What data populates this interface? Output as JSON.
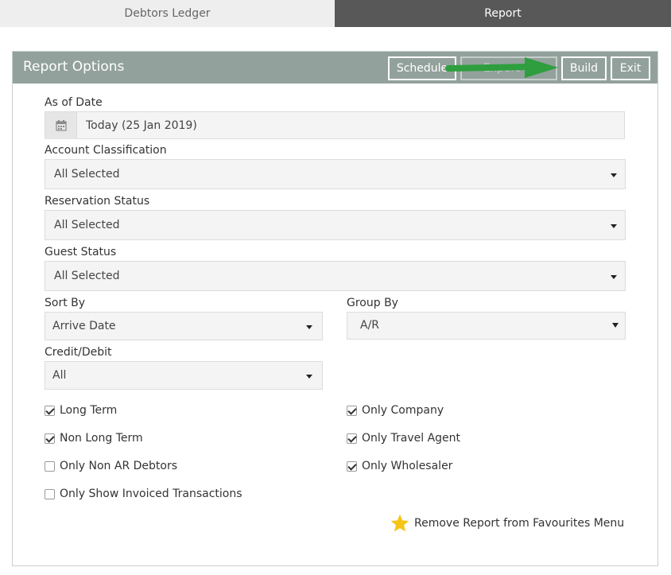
{
  "tabs": [
    {
      "label": "Debtors Ledger",
      "active": false
    },
    {
      "label": "Report",
      "active": true
    }
  ],
  "panel": {
    "title": "Report Options",
    "buttons": {
      "schedule": "Schedule",
      "export": "Export to",
      "build": "Build",
      "exit": "Exit"
    }
  },
  "form": {
    "as_of_date": {
      "label": "As of Date",
      "value": "Today (25 Jan 2019)",
      "icon": "calendar-icon"
    },
    "account_classification": {
      "label": "Account Classification",
      "value": "All Selected"
    },
    "reservation_status": {
      "label": "Reservation Status",
      "value": "All Selected"
    },
    "guest_status": {
      "label": "Guest Status",
      "value": "All Selected"
    },
    "sort_by": {
      "label": "Sort By",
      "value": "Arrive Date"
    },
    "group_by": {
      "label": "Group By",
      "value": "A/R"
    },
    "credit_debit": {
      "label": "Credit/Debit",
      "value": "All"
    }
  },
  "checkboxes": {
    "long_term": {
      "label": "Long Term",
      "checked": true
    },
    "non_long_term": {
      "label": "Non Long Term",
      "checked": true
    },
    "only_non_ar_debtors": {
      "label": "Only Non AR Debtors",
      "checked": false
    },
    "only_show_invoiced": {
      "label": "Only Show Invoiced Transactions",
      "checked": false
    },
    "only_company": {
      "label": "Only Company",
      "checked": true
    },
    "only_travel_agent": {
      "label": "Only Travel Agent",
      "checked": true
    },
    "only_wholesaler": {
      "label": "Only Wholesaler",
      "checked": true
    }
  },
  "favourites": {
    "label": "Remove Report from Favourites Menu",
    "icon": "star-icon"
  },
  "colors": {
    "header_bg": "#92a19c",
    "active_tab_bg": "#585858",
    "inactive_tab_bg": "#eeeeee",
    "field_bg": "#f4f4f4",
    "annotation_arrow": "#2e9e3e",
    "star": "#f5c518"
  }
}
